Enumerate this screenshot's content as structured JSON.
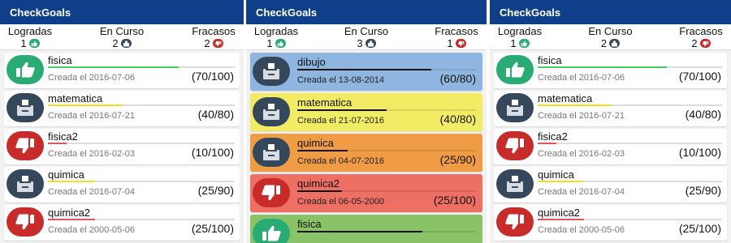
{
  "screens": [
    {
      "app_title": "CheckGoals",
      "stats": [
        {
          "label": "Logradas",
          "count": "1",
          "icon": "thumbs-up-icon"
        },
        {
          "label": "En Curso",
          "count": "2",
          "icon": "ballot-box-icon"
        },
        {
          "label": "Fracasos",
          "count": "2",
          "icon": "thumbs-down-icon"
        }
      ],
      "goals": [
        {
          "name": "fisica",
          "created": "Creada el 2016-07-06",
          "score": "(70/100)",
          "status": "achieved",
          "progress": 0.7
        },
        {
          "name": "matematica",
          "created": "Creada el 2016-07-21",
          "score": "(40/80)",
          "status": "inprogress",
          "progress": 0.4
        },
        {
          "name": "fisica2",
          "created": "Creada el 2016-02-03",
          "score": "(10/100)",
          "status": "failed",
          "progress": 0.1
        },
        {
          "name": "quimica",
          "created": "Creada el 2016-07-04",
          "score": "(25/90)",
          "status": "inprogress",
          "progress": 0.25
        },
        {
          "name": "quimica2",
          "created": "Creada el 2000-05-06",
          "score": "(25/100)",
          "status": "failed",
          "progress": 0.25
        }
      ]
    },
    {
      "app_title": "CheckGoals",
      "stats": [
        {
          "label": "Logradas",
          "count": "1",
          "icon": "thumbs-up-icon"
        },
        {
          "label": "En Curso",
          "count": "3",
          "icon": "ballot-box-icon"
        },
        {
          "label": "Fracasos",
          "count": "1",
          "icon": "thumbs-down-icon"
        }
      ],
      "goals": [
        {
          "name": "dibujo",
          "created": "Creada el 13-08-2014",
          "score": "(60/80)",
          "status": "inprogress",
          "progress": 0.75,
          "bg": "#8fb6e0"
        },
        {
          "name": "matematica",
          "created": "Creada el 21-07-2016",
          "score": "(40/80)",
          "status": "inprogress",
          "progress": 0.5,
          "bg": "#f2ec64"
        },
        {
          "name": "quimica",
          "created": "Creada el 04-07-2016",
          "score": "(25/90)",
          "status": "inprogress",
          "progress": 0.28,
          "bg": "#ef9c45"
        },
        {
          "name": "quimica2",
          "created": "Creada el 06-05-2000",
          "score": "(25/100)",
          "status": "failed",
          "progress": 0.25,
          "bg": "#ee6f63"
        },
        {
          "name": "fisica",
          "created": "",
          "score": "",
          "status": "achieved",
          "progress": 0.7,
          "bg": "#8ac267"
        }
      ]
    },
    {
      "app_title": "CheckGoals",
      "stats": [
        {
          "label": "Logradas",
          "count": "1",
          "icon": "thumbs-up-icon"
        },
        {
          "label": "En Curso",
          "count": "2",
          "icon": "ballot-box-icon"
        },
        {
          "label": "Fracasos",
          "count": "2",
          "icon": "thumbs-down-icon"
        }
      ],
      "goals": [
        {
          "name": "fisica",
          "created": "Creada el 2016-07-06",
          "score": "(70/100)",
          "status": "achieved",
          "progress": 0.7
        },
        {
          "name": "matematica",
          "created": "Creada el 2016-07-21",
          "score": "(40/80)",
          "status": "inprogress",
          "progress": 0.4
        },
        {
          "name": "fisica2",
          "created": "Creada el 2016-02-03",
          "score": "(10/100)",
          "status": "failed",
          "progress": 0.1
        },
        {
          "name": "quimica",
          "created": "Creada el 2016-07-04",
          "score": "(25/90)",
          "status": "inprogress",
          "progress": 0.25
        },
        {
          "name": "quimica2",
          "created": "Creada el 2000-05-06",
          "score": "(25/100)",
          "status": "failed",
          "progress": 0.25
        }
      ]
    }
  ]
}
